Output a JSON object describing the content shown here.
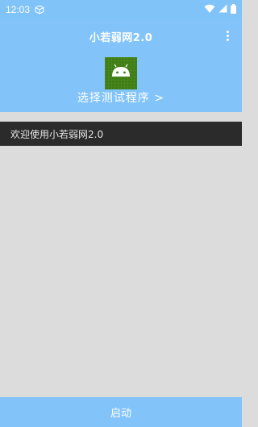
{
  "status_bar": {
    "time": "12:03",
    "icons": [
      "cube-icon",
      "wifi-icon",
      "signal-icon",
      "battery-icon"
    ]
  },
  "app_bar": {
    "title": "小若弱网2.0",
    "menu_icon": "overflow-menu-icon",
    "app_icon": "android-robot-icon",
    "program_select_label": "选择测试程序 >"
  },
  "welcome": {
    "text": "欢迎使用小若弱网2.0"
  },
  "footer": {
    "start_label": "启动"
  },
  "colors": {
    "primary": "#82c4fa",
    "welcome_bg": "#2b2b2b",
    "page_bg": "#dcdcdc",
    "icon_bg": "#3f7d16"
  }
}
